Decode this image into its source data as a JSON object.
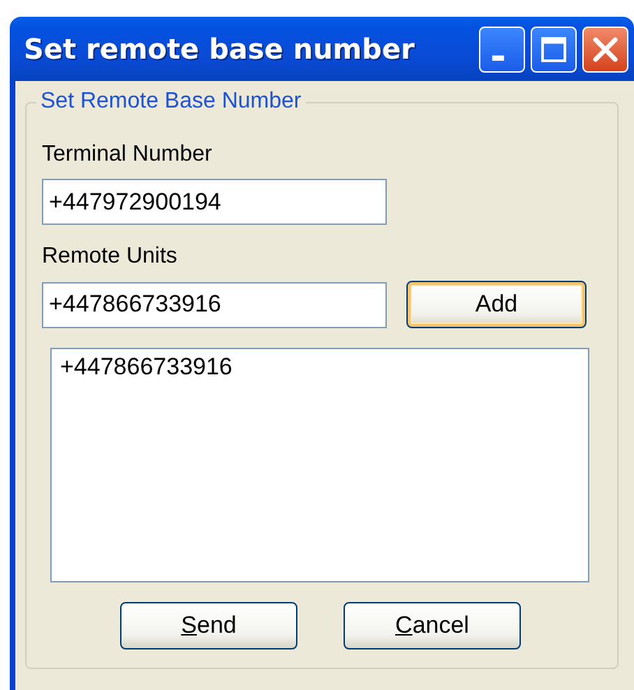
{
  "window": {
    "title": "Set remote base number"
  },
  "group": {
    "title": "Set Remote Base Number"
  },
  "fields": [
    {
      "label": "Terminal Number",
      "value": "+447972900194"
    },
    {
      "label": "Remote Units",
      "value": "+447866733916"
    }
  ],
  "add_button": {
    "label": "Add",
    "default": true
  },
  "list": {
    "items": [
      {
        "text": "+447866733916",
        "selected": false
      }
    ]
  },
  "buttons": [
    {
      "label": "Send"
    },
    {
      "label": "Cancel"
    }
  ]
}
